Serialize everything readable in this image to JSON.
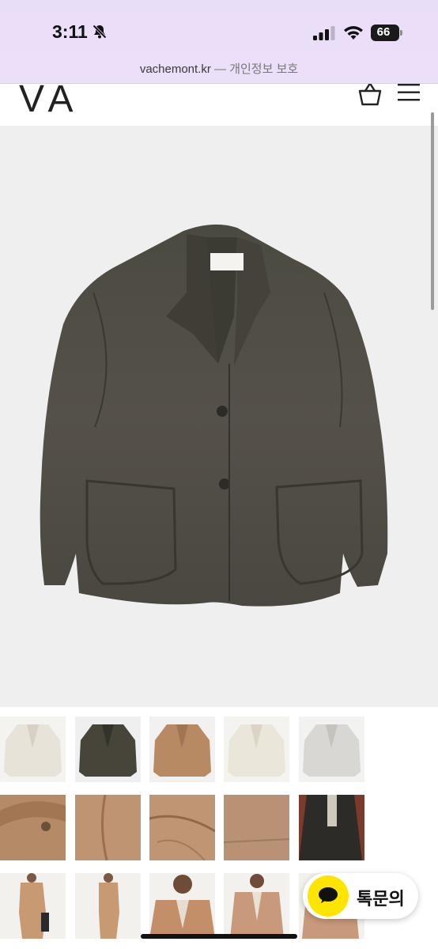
{
  "status_bar": {
    "time": "3:11",
    "battery_level": "66",
    "icons": [
      "bell-slash-icon",
      "cellular-signal-icon",
      "wifi-icon",
      "battery-icon"
    ]
  },
  "address_bar": {
    "host": "vachemont.kr",
    "separator": "—",
    "privacy_label": "개인정보 보호"
  },
  "header": {
    "logo_text": "VA",
    "icons": [
      "shopping-basket-icon",
      "hamburger-menu-icon"
    ]
  },
  "product": {
    "main_image": "olive-brown-linen-jacket"
  },
  "thumbnails": [
    {
      "row": 1,
      "items": [
        "cream-jacket",
        "dark-olive-jacket",
        "tan-jacket",
        "ivory-jacket",
        "light-gray-jacket"
      ]
    },
    {
      "row": 2,
      "items": [
        "tan-collar-detail",
        "tan-seam-detail",
        "tan-pocket-detail",
        "tan-fabric-detail",
        "model-dark-jacket"
      ]
    },
    {
      "row": 3,
      "items": [
        "model-tan-suit-front",
        "model-tan-suit-side",
        "model-tan-jacket-closeup",
        "model-tan-jacket-front",
        "model-tan-jacket-partial"
      ]
    }
  ],
  "chat_button": {
    "label": "톡문의",
    "color": "#fee500"
  },
  "colors": {
    "chrome_bg": "#ebdef8",
    "hero_bg": "#efefef",
    "kakao_yellow": "#fee500"
  }
}
